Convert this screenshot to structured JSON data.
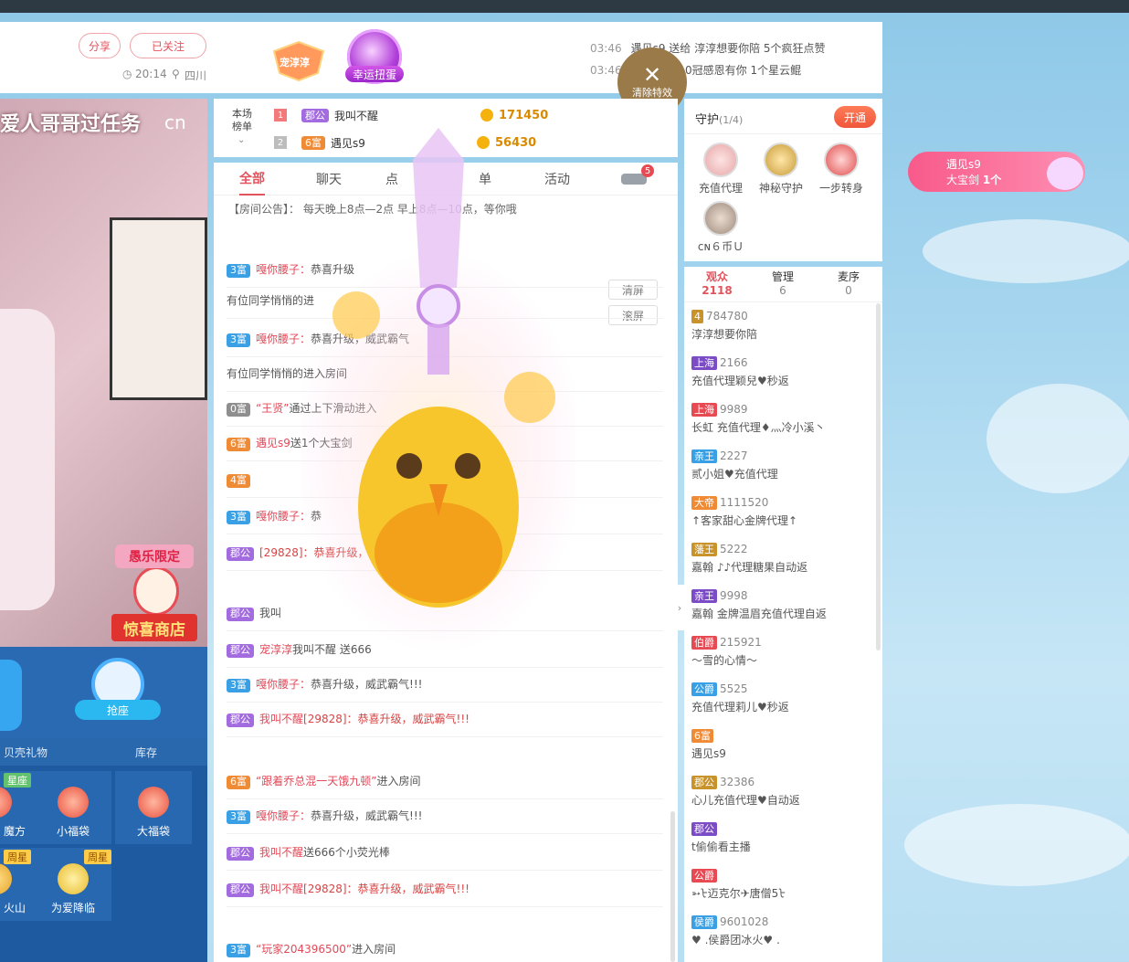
{
  "header": {
    "share_label": "分享",
    "followed_label": "已关注",
    "time": "20:14",
    "location": "四川",
    "pet_badge": "宠淳淳",
    "lucky_label": "幸运扭蛋",
    "notices": [
      {
        "time": "03:46",
        "text": "遇见s9 送给 淳淳想要你陪 5个疯狂点赞"
      },
      {
        "time": "03:46",
        "text": "送给 丞丞10冠感恩有你 1个星云鲲"
      }
    ],
    "clear_fx_label": "清除特效"
  },
  "video": {
    "title": "爱人哥哥过任务",
    "watermark": "cn",
    "shop_top": "愚乐限定",
    "shop_bottom": "惊喜商店",
    "seat_label": "抢座",
    "gift_tabs": [
      "贝壳礼物",
      "库存"
    ],
    "gifts": [
      {
        "name": "魔方",
        "tag": "星座"
      },
      {
        "name": "小福袋",
        "tag": ""
      },
      {
        "name": "大福袋",
        "tag": ""
      },
      {
        "name": "火山",
        "tag": "周星"
      },
      {
        "name": "为爱降临",
        "tag": "周星"
      }
    ]
  },
  "ranking": {
    "label": "本场榜单",
    "rows": [
      {
        "rank": "1",
        "level": "郡公",
        "name": "我叫不醒",
        "coins": "171450"
      },
      {
        "rank": "2",
        "level": "6富",
        "name": "遇见s9",
        "coins": "56430"
      }
    ]
  },
  "chat": {
    "tabs": [
      "全部",
      "聊天",
      "点",
      "单",
      "活动"
    ],
    "car_count": "5",
    "announcement": "【房间公告】：  每天晚上8点—2点  早上8点—10点，等你哦",
    "clear_label": "清屏",
    "scroll_label": "滚屏",
    "messages": [
      {
        "lvl": "3富",
        "name": "嘎你腰子：",
        "text": "恭喜升级"
      },
      {
        "lvl": "",
        "name": "",
        "text": "有位同学悄悄的进"
      },
      {
        "lvl": "3富",
        "name": "嘎你腰子：",
        "text": "恭喜升级，威武霸气"
      },
      {
        "lvl": "",
        "name": "",
        "text": "有位同学悄悄的进入房间"
      },
      {
        "lvl": "0富",
        "name": "“王贤”",
        "text": "通过上下滑动进入"
      },
      {
        "lvl": "6富",
        "name": "遇见s9",
        "text": "送1个大宝剑"
      },
      {
        "lvl": "4富",
        "name": "",
        "text": ""
      },
      {
        "lvl": "3富",
        "name": "嘎你腰子：",
        "text": "恭"
      },
      {
        "lvl": "郡公",
        "name": "",
        "text": "[29828]：恭喜升级，威武霸气!!!"
      },
      {
        "lvl": "郡公",
        "name": "",
        "text": "我叫"
      },
      {
        "lvl": "郡公",
        "name": "宠淳淳",
        "text": "我叫不醒 送666"
      },
      {
        "lvl": "3富",
        "name": "嘎你腰子：",
        "text": "恭喜升级，威武霸气!!!"
      },
      {
        "lvl": "郡公",
        "name": "我叫不醒",
        "text": "[29828]：恭喜升级，威武霸气!!!"
      },
      {
        "lvl": "6富",
        "name": "“跟着乔总混一天饿九顿”",
        "text": "进入房间"
      },
      {
        "lvl": "3富",
        "name": "嘎你腰子：",
        "text": "恭喜升级，威武霸气!!!"
      },
      {
        "lvl": "郡公",
        "name": "我叫不醒",
        "text": "送666个小荧光棒"
      },
      {
        "lvl": "郡公",
        "name": "我叫不醒",
        "text": "[29828]：恭喜升级，威武霸气!!!"
      },
      {
        "lvl": "3富",
        "name": "“玩家204396500”",
        "text": "进入房间"
      }
    ]
  },
  "guard": {
    "title": "守护",
    "count": "(1/4)",
    "open_label": "开通",
    "items": [
      "充值代理",
      "神秘守护",
      "一步转身",
      "ᴄɴ６币Ｕ"
    ]
  },
  "audience": {
    "tabs": [
      {
        "label": "观众",
        "count": "2118"
      },
      {
        "label": "管理",
        "count": "6"
      },
      {
        "label": "麦序",
        "count": "0"
      }
    ],
    "users": [
      {
        "badges": [
          "4"
        ],
        "num": "784780",
        "name": "淳淳想要你陪"
      },
      {
        "badges": [
          "上海"
        ],
        "num": "2166",
        "name": "充值代理颖兒♥秒返"
      },
      {
        "badges": [
          "上海"
        ],
        "num": "9989",
        "name": "长虹 充值代理♦灬冷小溪丶"
      },
      {
        "badges": [
          "亲王"
        ],
        "num": "2227",
        "name": "贰小姐♥充值代理"
      },
      {
        "badges": [
          "大帝"
        ],
        "num": "1111520",
        "name": "↑客家甜心金牌代理↑"
      },
      {
        "badges": [
          "藩王"
        ],
        "num": "5222",
        "name": "嘉翰 ♪♪代理糖果自动返"
      },
      {
        "badges": [
          "亲王"
        ],
        "num": "9998",
        "name": "嘉翰 金牌温眉充值代理自返"
      },
      {
        "badges": [
          "伯爵"
        ],
        "num": "215921",
        "name": "～雪的心情～"
      },
      {
        "badges": [
          "公爵"
        ],
        "num": "5525",
        "name": "充值代理莉儿♥秒返"
      },
      {
        "badges": [
          "6富"
        ],
        "num": "",
        "name": "遇见s9"
      },
      {
        "badges": [
          "郡公"
        ],
        "num": "32386",
        "name": "心儿充值代理♥自动返"
      },
      {
        "badges": [
          "郡公"
        ],
        "num": "",
        "name": "t偷偷看主播"
      },
      {
        "badges": [
          "公爵"
        ],
        "num": "",
        "name": "➳ᡶ迈克尔✈唐僧5ᡶ"
      },
      {
        "badges": [
          "侯爵"
        ],
        "num": "9601028",
        "name": "♥ .侯爵团冰火♥ ."
      }
    ]
  },
  "banner": {
    "sender": "遇见s9",
    "gift": "大宝剑",
    "count": "1个"
  },
  "colors": {
    "accent": "#e2535d",
    "panel": "#ffffff",
    "sky": "#a7d6ef",
    "seat": "#2a6ab3"
  }
}
